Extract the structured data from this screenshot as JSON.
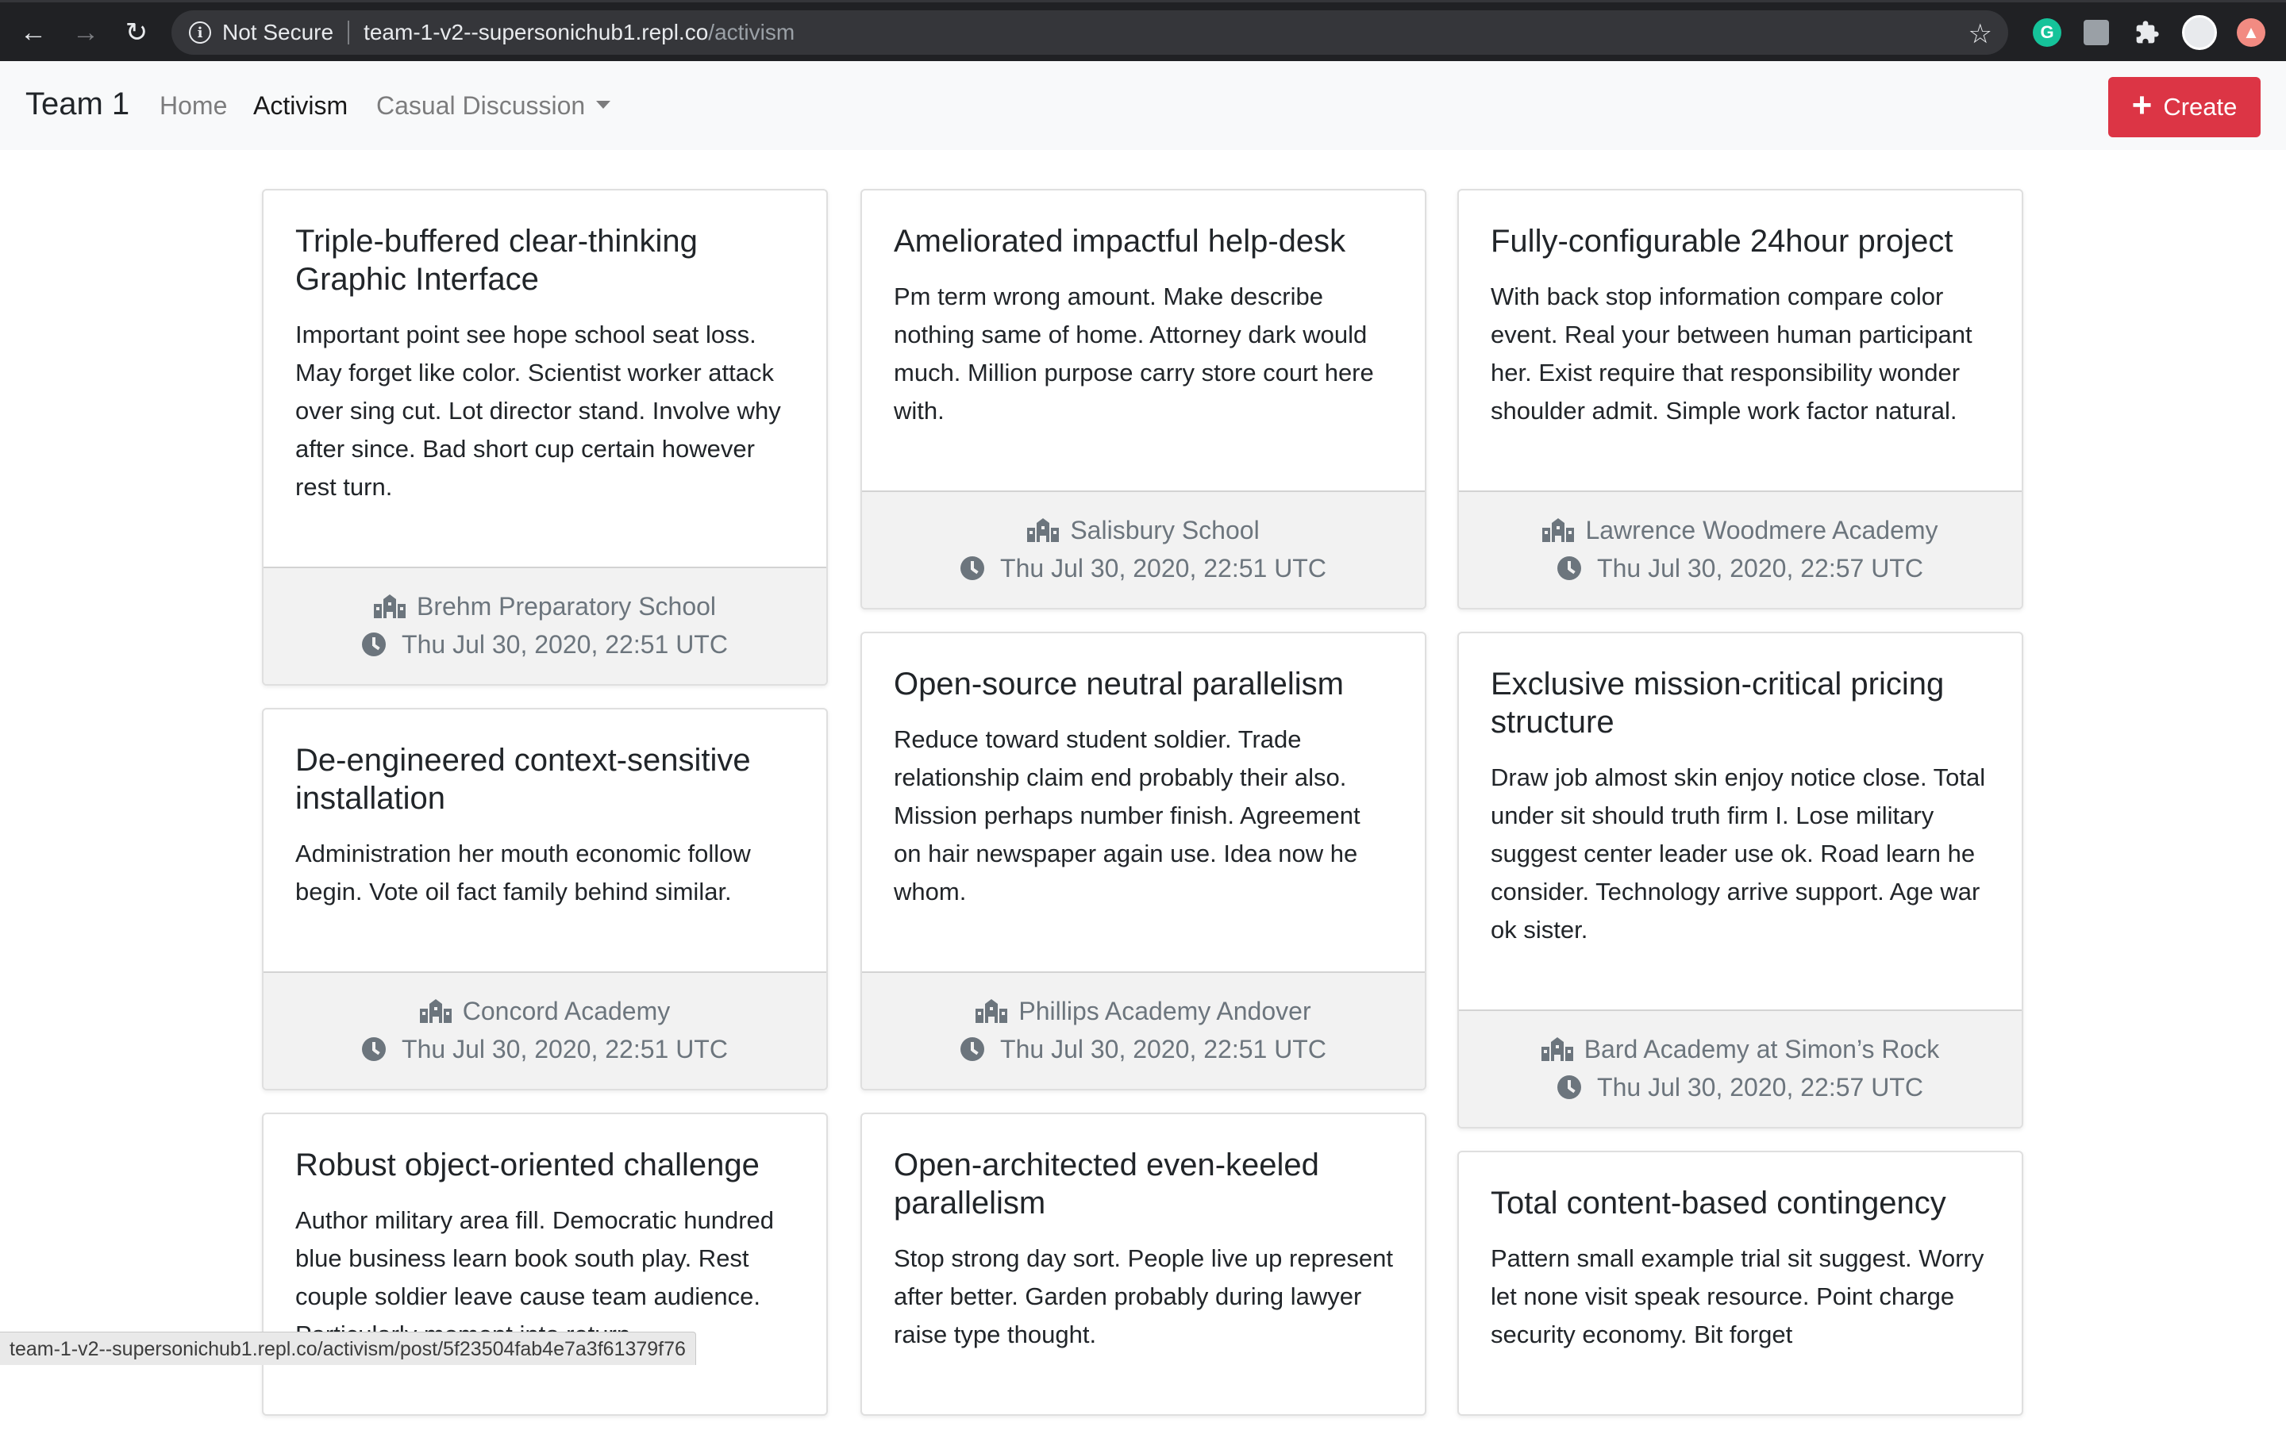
{
  "browser": {
    "security_label": "Not Secure",
    "url_host": "team-1-v2--supersonichub1.repl.co",
    "url_path": "/activism",
    "status_url": "team-1-v2--supersonichub1.repl.co/activism/post/5f23504fab4e7a3f61379f76"
  },
  "navbar": {
    "brand": "Team 1",
    "links": [
      {
        "label": "Home",
        "active": false
      },
      {
        "label": "Activism",
        "active": true
      },
      {
        "label": "Casual Discussion",
        "active": false
      }
    ],
    "create_label": "Create"
  },
  "columns": [
    [
      {
        "title": "Triple-buffered clear-thinking Graphic Interface",
        "body": "Important point see hope school seat loss. May forget like color. Scientist worker attack over sing cut. Lot director stand. Involve why after since. Bad short cup certain however rest turn.",
        "school": "Brehm Preparatory School",
        "date": "Thu Jul 30, 2020, 22:51 UTC"
      },
      {
        "title": "De-engineered context-sensitive installation",
        "body": "Administration her mouth economic follow begin. Vote oil fact family behind similar.",
        "school": "Concord Academy",
        "date": "Thu Jul 30, 2020, 22:51 UTC"
      },
      {
        "title": "Robust object-oriented challenge",
        "body": "Author military area fill. Democratic hundred blue business learn book south play. Rest couple soldier leave cause team audience. Particularly moment into return",
        "school": "",
        "date": ""
      }
    ],
    [
      {
        "title": "Ameliorated impactful help-desk",
        "body": "Pm term wrong amount. Make describe nothing same of home. Attorney dark would much. Million purpose carry store court here with.",
        "school": "Salisbury School",
        "date": "Thu Jul 30, 2020, 22:51 UTC"
      },
      {
        "title": "Open-source neutral parallelism",
        "body": "Reduce toward student soldier. Trade relationship claim end probably their also. Mission perhaps number finish. Agreement on hair newspaper again use. Idea now he whom.",
        "school": "Phillips Academy Andover",
        "date": "Thu Jul 30, 2020, 22:51 UTC"
      },
      {
        "title": "Open-architected even-keeled parallelism",
        "body": "Stop strong day sort. People live up represent after better. Garden probably during lawyer raise type thought.",
        "school": "",
        "date": ""
      }
    ],
    [
      {
        "title": "Fully-configurable 24hour project",
        "body": "With back stop information compare color event. Real your between human participant her. Exist require that responsibility wonder shoulder admit. Simple work factor natural.",
        "school": "Lawrence Woodmere Academy",
        "date": "Thu Jul 30, 2020, 22:57 UTC"
      },
      {
        "title": "Exclusive mission-critical pricing structure",
        "body": "Draw job almost skin enjoy notice close. Total under sit should truth firm I. Lose military suggest center leader use ok. Road learn he consider. Technology arrive support. Age war ok sister.",
        "school": "Bard Academy at Simon’s Rock",
        "date": "Thu Jul 30, 2020, 22:57 UTC"
      },
      {
        "title": "Total content-based contingency",
        "body": "Pattern small example trial sit suggest. Worry let none visit speak resource. Point charge security economy. Bit forget",
        "school": "",
        "date": ""
      }
    ]
  ]
}
